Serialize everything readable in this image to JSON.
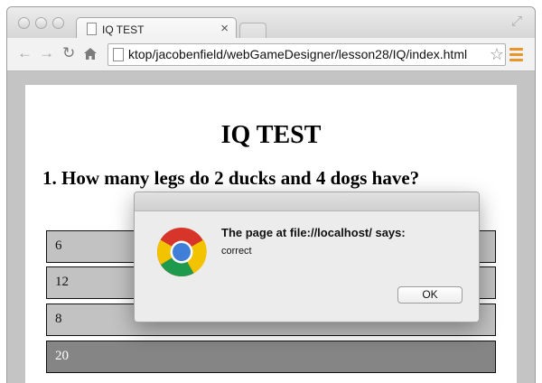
{
  "browser": {
    "tab_title": "IQ TEST",
    "tab_close": "×",
    "url": "ktop/jacobenfield/webGameDesigner/lesson28/IQ/index.html",
    "icons": {
      "back": "back-arrow-icon",
      "forward": "forward-arrow-icon",
      "reload": "reload-icon",
      "home": "home-icon",
      "bookmark": "star-icon",
      "menu": "hamburger-menu-icon",
      "fullscreen": "fullscreen-icon"
    },
    "menu_color": "#e8962a"
  },
  "page": {
    "heading": "IQ TEST",
    "question": "1. How many legs do 2 ducks and 4 dogs have?",
    "answers": [
      {
        "label": "6",
        "selected": false
      },
      {
        "label": "12",
        "selected": false
      },
      {
        "label": "8",
        "selected": false
      },
      {
        "label": "20",
        "selected": true
      }
    ],
    "answer_color": "#c2c2c2",
    "selected_color": "#858585"
  },
  "dialog": {
    "title": "The page at file://localhost/ says:",
    "message": "correct",
    "ok_label": "OK",
    "icon": "chrome-logo-icon"
  }
}
